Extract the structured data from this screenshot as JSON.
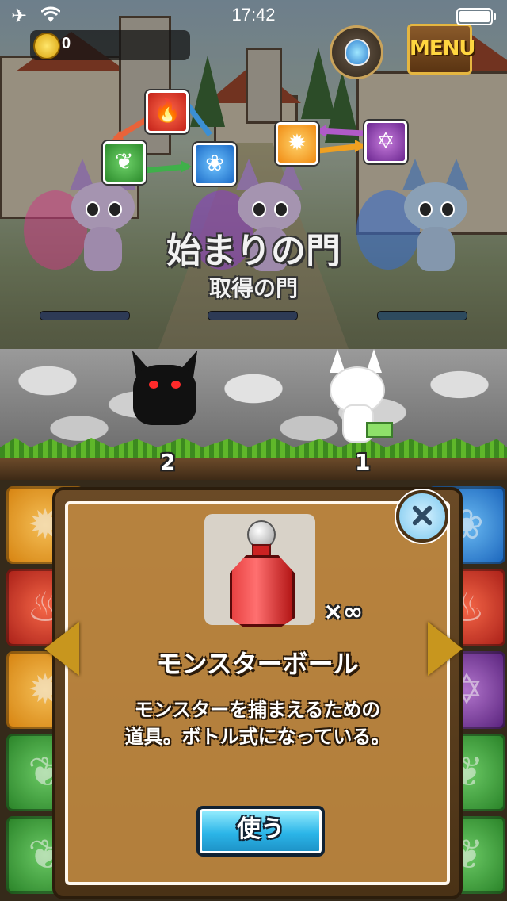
{
  "status_bar": {
    "airplane_icon": "airplane-icon",
    "wifi_icon": "wifi-icon",
    "time": "17:42",
    "battery_level": 1.0
  },
  "hud": {
    "coins": "0",
    "coin_icon": "coin-icon",
    "potion_icon": "potion-icon",
    "menu_label": "MENU"
  },
  "stage": {
    "title": "始まりの門",
    "subtitle": "取得の門"
  },
  "battle": {
    "enemy_turn": "2",
    "ally_turn": "1"
  },
  "element_chart": {
    "left": [
      "fire",
      "leaf",
      "water"
    ],
    "right": [
      "sun",
      "dark"
    ]
  },
  "item_dialog": {
    "name": "モンスターボール",
    "quantity": "×∞",
    "description_line1": "モンスターを捕まえるための",
    "description_line2": "道具。ボトル式になっている。",
    "use_button": "使う",
    "close_icon": "close-icon",
    "prev_icon": "chevron-left-icon",
    "next_icon": "chevron-right-icon"
  },
  "colors": {
    "accent_blue": "#2bb5e8",
    "frame_brown": "#4a3216",
    "gold": "#c8961e"
  }
}
